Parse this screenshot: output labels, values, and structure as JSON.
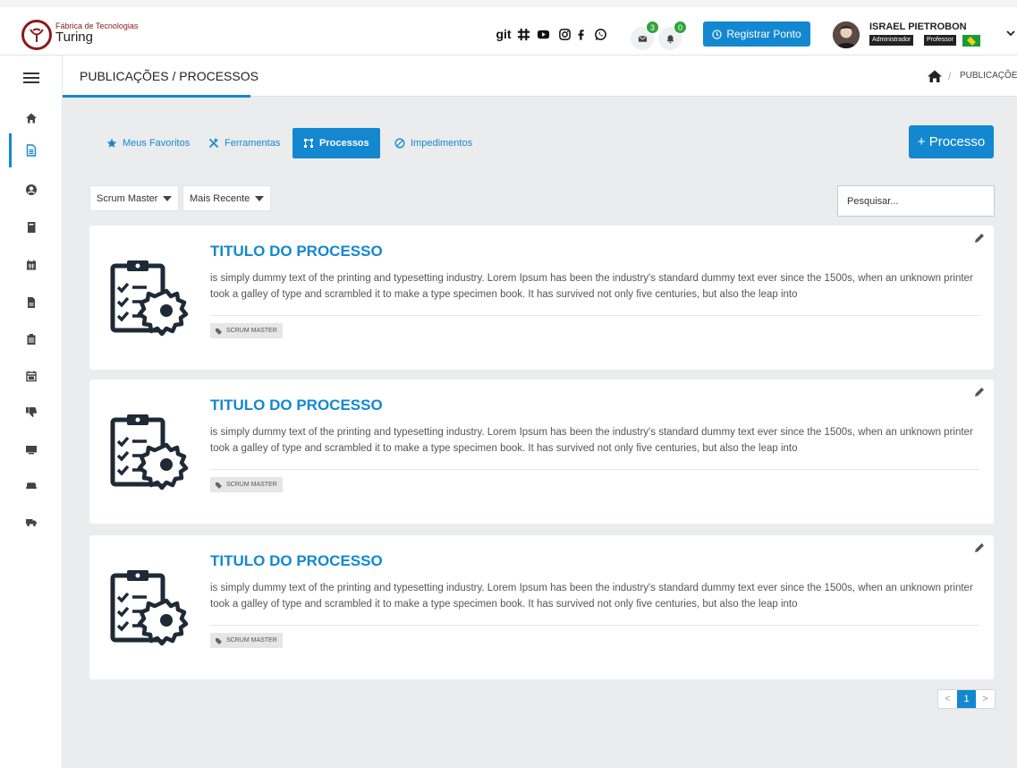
{
  "header": {
    "brand_small": "Fábrica de Tecnologias",
    "brand_name": "Turing",
    "social_icons": [
      "git-icon",
      "slack-icon",
      "youtube-icon",
      "instagram-icon",
      "facebook-icon",
      "whatsapp-icon"
    ],
    "git_label": "git",
    "mail_badge": "3",
    "notification_badge": "0",
    "register_button": "Registrar Ponto",
    "user_name": "ISRAEL PIETROBON",
    "roles": [
      "Administrador",
      "Professor"
    ],
    "badge_color": "#2ea43a",
    "accent": "#1388d0"
  },
  "sidebar": {
    "items": [
      "home-icon",
      "document-icon",
      "user-circle-icon",
      "book-icon",
      "calendar-icon",
      "file-icon",
      "clipboard-icon",
      "calendar-check-icon",
      "thumbs-down-icon",
      "monitor-icon",
      "keyboard-icon",
      "truck-icon"
    ],
    "active_index": 1
  },
  "page": {
    "title": "PUBLICAÇÕES / PROCESSOS",
    "breadcrumb_current": "PUBLICAÇÕES"
  },
  "tabs": [
    {
      "label": "Meus Favoritos",
      "icon": "star-icon"
    },
    {
      "label": "Ferramentas",
      "icon": "tools-icon"
    },
    {
      "label": "Processos",
      "icon": "process-icon",
      "active": true
    },
    {
      "label": "Impedimentos",
      "icon": "ban-icon"
    }
  ],
  "new_button": "+ Processo",
  "filters": {
    "role": "Scrum Master",
    "sort": "Mais Recente",
    "search_placeholder": "Pesquisar..."
  },
  "cards": [
    {
      "title": "TITULO DO PROCESSO",
      "text": "is simply dummy text of the printing and typesetting industry. Lorem Ipsum has been the industry's standard dummy text ever since the 1500s, when an unknown printer took a galley of type and scrambled it to make a type specimen book. It has survived not only five centuries, but also the leap into",
      "tag": "SCRUM MASTER"
    },
    {
      "title": "TITULO DO PROCESSO",
      "text": "is simply dummy text of the printing and typesetting industry. Lorem Ipsum has been the industry's standard dummy text ever since the 1500s, when an unknown printer took a galley of type and scrambled it to make a type specimen book. It has survived not only five centuries, but also the leap into",
      "tag": "SCRUM MASTER"
    },
    {
      "title": "TITULO DO PROCESSO",
      "text": "is simply dummy text of the printing and typesetting industry. Lorem Ipsum has been the industry's standard dummy text ever since the 1500s, when an unknown printer took a galley of type and scrambled it to make a type specimen book. It has survived not only five centuries, but also the leap into",
      "tag": "SCRUM MASTER"
    }
  ],
  "pagination": {
    "prev": "<",
    "current": "1",
    "next": ">"
  }
}
